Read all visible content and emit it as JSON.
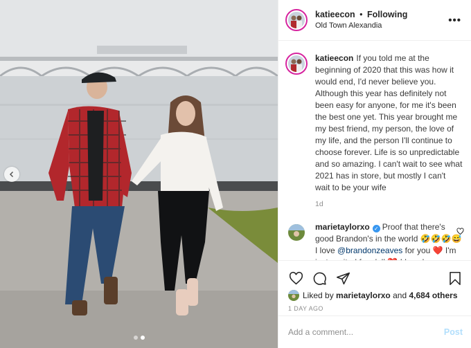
{
  "post": {
    "username": "katieecon",
    "separator": "•",
    "follow_status": "Following",
    "location": "Old Town Alexandia",
    "more_label": "•••"
  },
  "caption": {
    "username": "katieecon",
    "text": "If you told me at the beginning of 2020 that this was how it would end, I'd never believe you. Although this year has definitely not been easy for anyone, for me it's been the best one yet. This year brought me my best friend, my person, the love of my life, and the person I'll continue to choose forever. Life is so unpredictable and so amazing. I can't wait to see what 2021 has in store, but mostly I can't wait to be your wife",
    "time": "1d"
  },
  "comment": {
    "username": "marietaylorxo",
    "part1": "Proof that there's good Brandon's in the world 🤣🤣🤣😅 I love",
    "mention": "@brandonzeaves",
    "part2": "for you ❤️ I'm just excited for y'all ❤️ I love love"
  },
  "likes": {
    "prefix": "Liked by",
    "user": "marietaylorxo",
    "and": "and",
    "count": "4,684 others"
  },
  "date": "1 DAY AGO",
  "add_comment": {
    "placeholder": "Add a comment...",
    "post_label": "Post"
  },
  "carousel": {
    "slides": 2,
    "active": 2
  },
  "colors": {
    "story_ring": "#d6249f",
    "verified": "#3897f0",
    "post_button_disabled": "#b2dffc",
    "secondary_text": "#8e8e8e"
  },
  "icons": [
    "chevron-left-icon",
    "more-icon",
    "verified-icon",
    "heart-icon",
    "comment-icon",
    "share-icon",
    "bookmark-icon"
  ]
}
